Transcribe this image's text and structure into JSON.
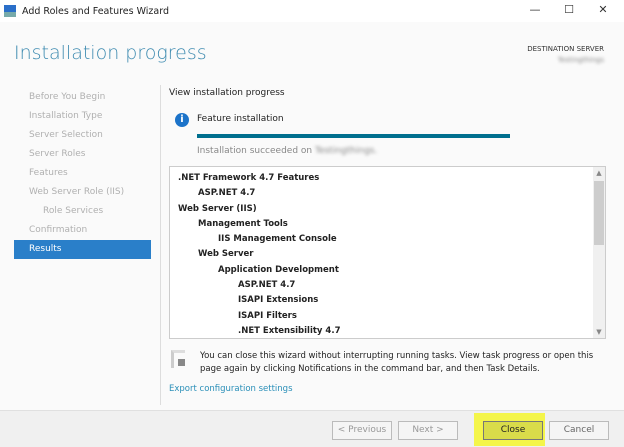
{
  "window": {
    "title": "Add Roles and Features Wizard"
  },
  "header": {
    "title": "Installation progress",
    "destination_label": "DESTINATION SERVER",
    "destination_server": "Testingthings"
  },
  "nav": {
    "items": [
      "Before You Begin",
      "Installation Type",
      "Server Selection",
      "Server Roles",
      "Features",
      "Web Server Role (IIS)",
      "Role Services",
      "Confirmation",
      "Results"
    ],
    "active": "Results"
  },
  "main": {
    "view_label": "View installation progress",
    "feature_label": "Feature installation",
    "progress_percent": 100,
    "success_prefix": "Installation succeeded on",
    "success_server": "Testingthings.",
    "results": [
      ".NET Framework 4.7 Features",
      "ASP.NET 4.7",
      "Web Server (IIS)",
      "Management Tools",
      "IIS Management Console",
      "Web Server",
      "Application Development",
      "ASP.NET 4.7",
      "ISAPI Extensions",
      "ISAPI Filters",
      ".NET Extensibility 4.7"
    ],
    "note": "You can close this wizard without interrupting running tasks. View task progress or open this page again by clicking Notifications in the command bar, and then Task Details.",
    "export_link": "Export configuration settings"
  },
  "footer": {
    "previous": "< Previous",
    "next": "Next >",
    "close": "Close",
    "cancel": "Cancel"
  },
  "colors": {
    "accent": "#2a7fc9",
    "progress": "#006f8e",
    "highlight": "#f4f54a"
  }
}
